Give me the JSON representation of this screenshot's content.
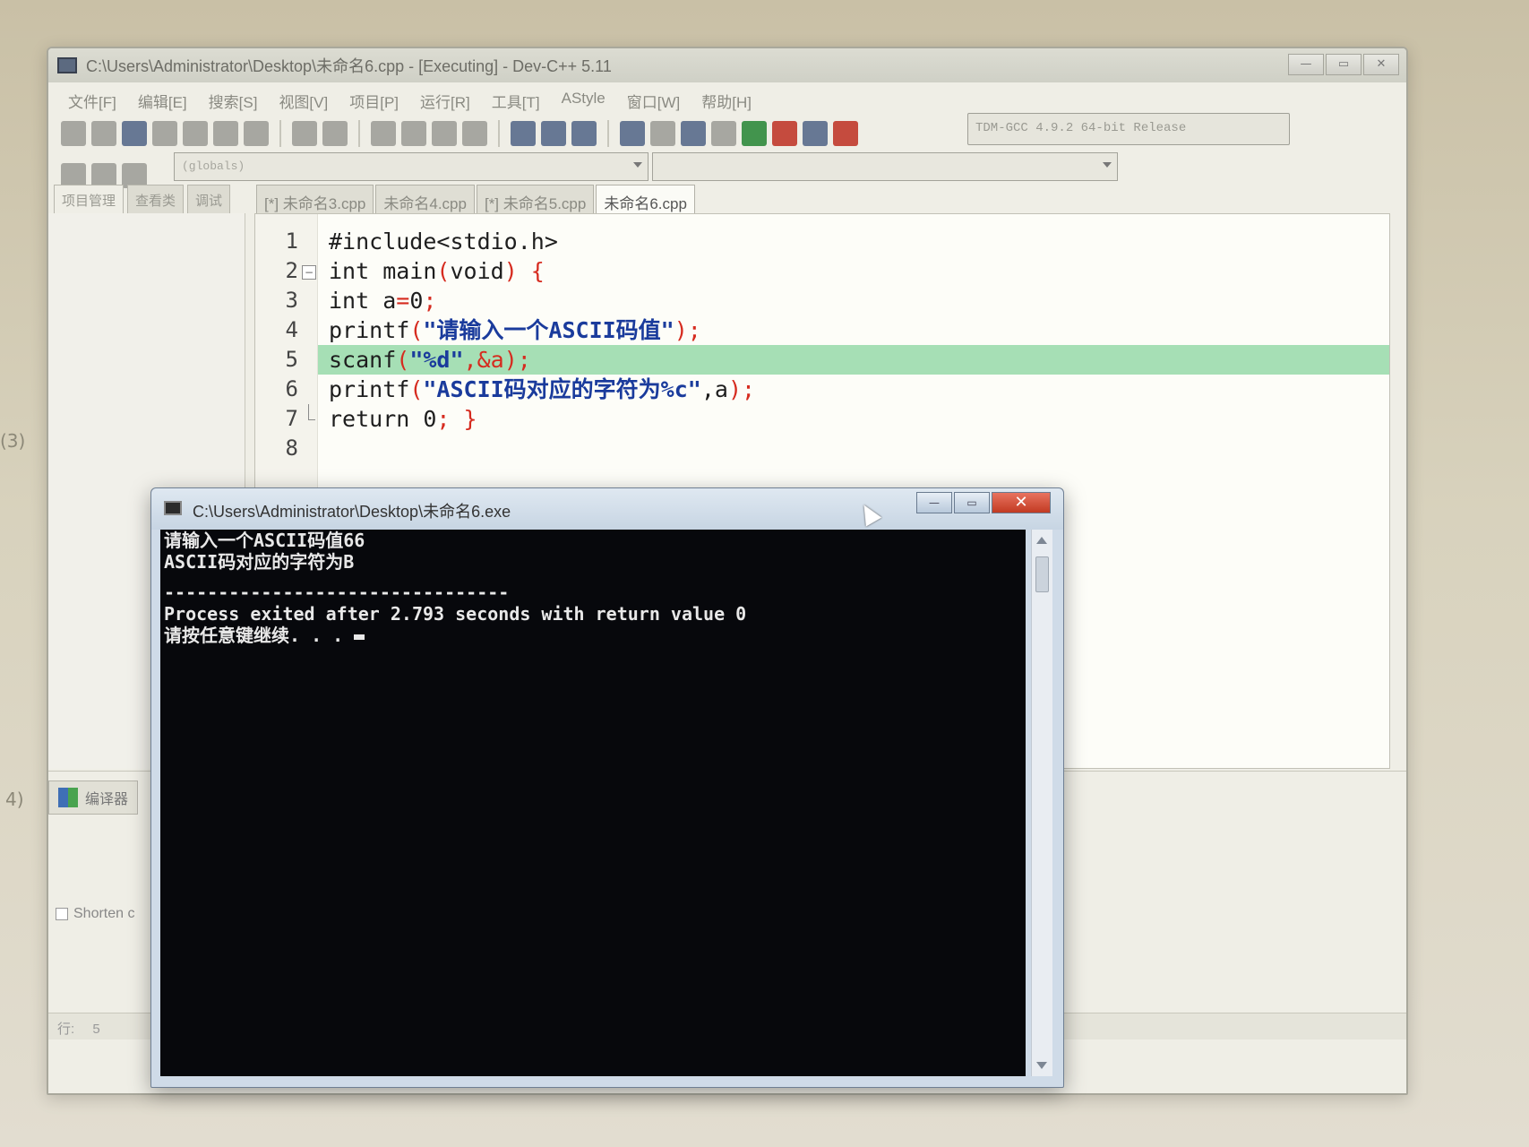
{
  "ide": {
    "title": "C:\\Users\\Administrator\\Desktop\\未命名6.cpp - [Executing] - Dev-C++ 5.11",
    "menu": [
      "文件[F]",
      "编辑[E]",
      "搜索[S]",
      "视图[V]",
      "项目[P]",
      "运行[R]",
      "工具[T]",
      "AStyle",
      "窗口[W]",
      "帮助[H]"
    ],
    "compiler": "TDM-GCC 4.9.2 64-bit Release",
    "scope": "(globals)",
    "left_tabs": [
      "项目管理",
      "查看类",
      "调试"
    ],
    "file_tabs": [
      "[*] 未命名3.cpp",
      "未命名4.cpp",
      "[*] 未命名5.cpp",
      "未命名6.cpp"
    ],
    "active_file_tab": 3,
    "bottom_tab": "编译器",
    "shorten_label": "Shorten c",
    "status": {
      "label": "行:",
      "value": "5"
    }
  },
  "code": {
    "lines": [
      {
        "n": "1",
        "parts": [
          {
            "t": "#include<stdio.h>",
            "c": "kw"
          }
        ]
      },
      {
        "n": "2",
        "parts": [
          {
            "t": "int main",
            "c": "kw"
          },
          {
            "t": "(",
            "c": "pn"
          },
          {
            "t": "void",
            "c": "kw"
          },
          {
            "t": ") {",
            "c": "pn"
          }
        ]
      },
      {
        "n": "3",
        "parts": [
          {
            "t": "int a",
            "c": "kw"
          },
          {
            "t": "=",
            "c": "pn"
          },
          {
            "t": "0",
            "c": "kw"
          },
          {
            "t": ";",
            "c": "pn"
          }
        ]
      },
      {
        "n": "4",
        "parts": [
          {
            "t": "printf",
            "c": "kw"
          },
          {
            "t": "(",
            "c": "pn"
          },
          {
            "t": "\"请输入一个ASCII码值\"",
            "c": "str"
          },
          {
            "t": ");",
            "c": "pn"
          }
        ]
      },
      {
        "n": "5",
        "parts": [
          {
            "t": "scanf",
            "c": "kw"
          },
          {
            "t": "(",
            "c": "pn"
          },
          {
            "t": "\"%d\"",
            "c": "str"
          },
          {
            "t": ",&a);",
            "c": "pn"
          }
        ]
      },
      {
        "n": "6",
        "parts": [
          {
            "t": "printf",
            "c": "kw"
          },
          {
            "t": "(",
            "c": "pn"
          },
          {
            "t": "\"ASCII码对应的字符为%c\"",
            "c": "str"
          },
          {
            "t": ",a",
            "c": "kw"
          },
          {
            "t": ");",
            "c": "pn"
          }
        ]
      },
      {
        "n": "7",
        "parts": [
          {
            "t": "return ",
            "c": "kw"
          },
          {
            "t": "0",
            "c": "kw"
          },
          {
            "t": "; }",
            "c": "pn"
          }
        ]
      },
      {
        "n": "8",
        "parts": []
      }
    ],
    "highlighted_line": "5"
  },
  "console": {
    "title": "C:\\Users\\Administrator\\Desktop\\未命名6.exe",
    "lines": [
      "请输入一个ASCII码值66",
      "ASCII码对应的字符为B",
      "",
      "--------------------------------",
      "Process exited after 2.793 seconds with return value 0",
      "请按任意键继续. . . "
    ]
  },
  "margin_marks": [
    "(3)",
    "4)"
  ]
}
